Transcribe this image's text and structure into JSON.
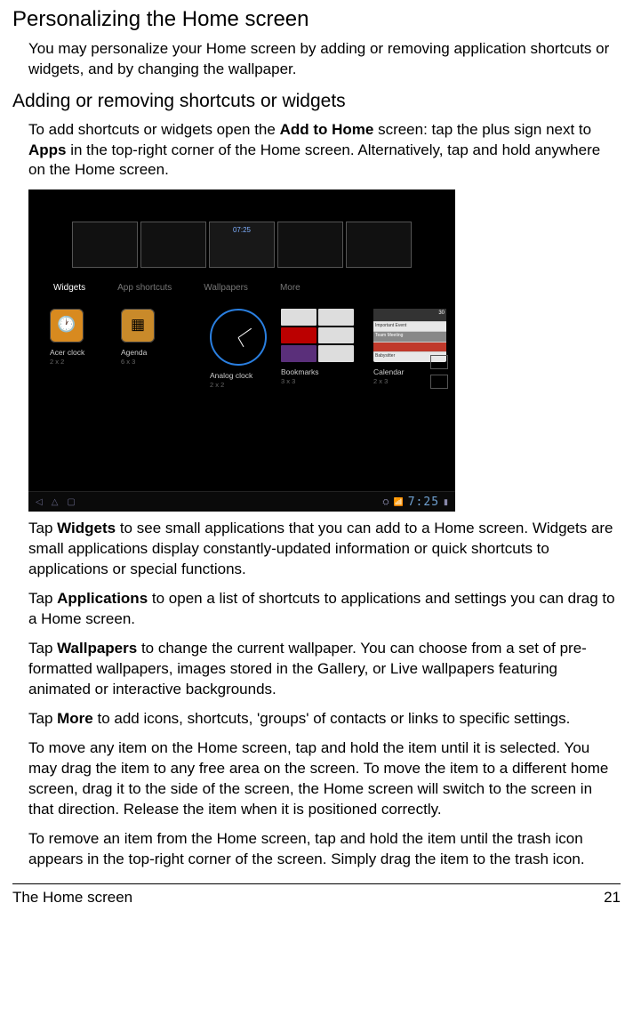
{
  "headings": {
    "h1": "Personalizing the Home screen",
    "h2": "Adding or removing shortcuts or widgets"
  },
  "intro": "You may personalize your Home screen by adding or removing application shortcuts or widgets, and by changing the wallpaper.",
  "addremove_p1a": "To add shortcuts or widgets open the ",
  "addremove_p1b": "Add to Home",
  "addremove_p1c": " screen: tap the plus sign next to ",
  "addremove_p1d": "Apps",
  "addremove_p1e": " in the top-right corner of the Home screen. Alternatively, tap and hold anywhere on the Home screen.",
  "screenshot": {
    "clock_small": "07:25",
    "tabs": {
      "widgets": "Widgets",
      "apps": "App shortcuts",
      "wallpapers": "Wallpapers",
      "more": "More"
    },
    "items": {
      "acer_clock": {
        "label": "Acer clock",
        "size": "2 x 2"
      },
      "agenda": {
        "label": "Agenda",
        "size": "6 x 3"
      },
      "analog": {
        "label": "Analog clock",
        "size": "2 x 2"
      },
      "bookmarks": {
        "label": "Bookmarks",
        "size": "3 x 3"
      },
      "calendar": {
        "label": "Calendar",
        "size": "2 x 3",
        "head": "30",
        "row1": "Important Event",
        "row2": "Team Meeting",
        "row3": "Babysitter"
      }
    },
    "status_time": "7:25"
  },
  "p_widgets_a": "Tap ",
  "p_widgets_b": "Widgets",
  "p_widgets_c": " to see small applications that you can add to a Home screen. Widgets are small applications display constantly-updated information or quick shortcuts to applications or special functions.",
  "p_apps_a": "Tap ",
  "p_apps_b": "Applications",
  "p_apps_c": " to open a list of shortcuts to applications and settings you can drag to a Home screen.",
  "p_wall_a": "Tap ",
  "p_wall_b": "Wallpapers",
  "p_wall_c": " to change the current wallpaper. You can choose from a set of pre-formatted wallpapers, images stored in the Gallery, or Live wallpapers featuring animated or interactive backgrounds.",
  "p_more_a": "Tap ",
  "p_more_b": "More",
  "p_more_c": " to add icons, shortcuts, 'groups' of contacts or links to specific settings.",
  "p_move": "To move any item on the Home screen, tap and hold the item until it is selected. You may drag the item to any free area on the screen. To move the item to a different home screen, drag it to the side of the screen, the Home screen will switch to the screen in that direction. Release the item when it is positioned correctly.",
  "p_remove": "To remove an item from the Home screen, tap and hold the item until the trash icon appears in the top-right corner of the screen. Simply drag the item to the trash icon.",
  "footer": {
    "left": "The Home screen",
    "right": "21"
  }
}
